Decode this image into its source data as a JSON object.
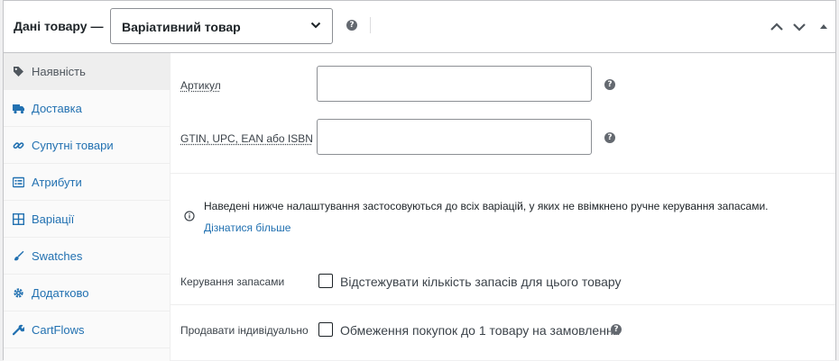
{
  "header": {
    "title": "Дані товару —",
    "product_type": "Варіативний товар",
    "help_icon": "help-icon",
    "collapse_up_icon": "chevron-up-icon",
    "collapse_down_icon": "chevron-down-icon",
    "toggle_icon": "triangle-up-icon"
  },
  "sidebar": {
    "items": [
      {
        "label": "Наявність",
        "icon": "tag-icon",
        "active": true
      },
      {
        "label": "Доставка",
        "icon": "truck-icon",
        "active": false
      },
      {
        "label": "Супутні товари",
        "icon": "link-icon",
        "active": false
      },
      {
        "label": "Атрибути",
        "icon": "list-icon",
        "active": false
      },
      {
        "label": "Варіації",
        "icon": "grid-icon",
        "active": false
      },
      {
        "label": "Swatches",
        "icon": "palette-icon",
        "active": false
      },
      {
        "label": "Додатково",
        "icon": "gear-icon",
        "active": false
      },
      {
        "label": "CartFlows",
        "icon": "wrench-icon",
        "active": false
      }
    ]
  },
  "inventory": {
    "sku_label": "Артикул",
    "sku_value": "",
    "gtin_label": "GTIN, UPC, EAN або ISBN",
    "gtin_value": "",
    "notice_text": "Наведені нижче налаштування застосовуються до всіх варіацій, у яких не ввімкнено ручне керування запасами.",
    "notice_link": "Дізнатися більше",
    "stock_label": "Керування запасами",
    "stock_checkbox_label": "Відстежувати кількість запасів для цього товару",
    "sold_individually_label": "Продавати індивідуально",
    "sold_individually_checkbox_label": "Обмеження покупок до 1 товару на замовлення"
  },
  "colors": {
    "link": "#2271b1",
    "border": "#c3c4c7",
    "active_tab_bg": "#eeeeee"
  }
}
